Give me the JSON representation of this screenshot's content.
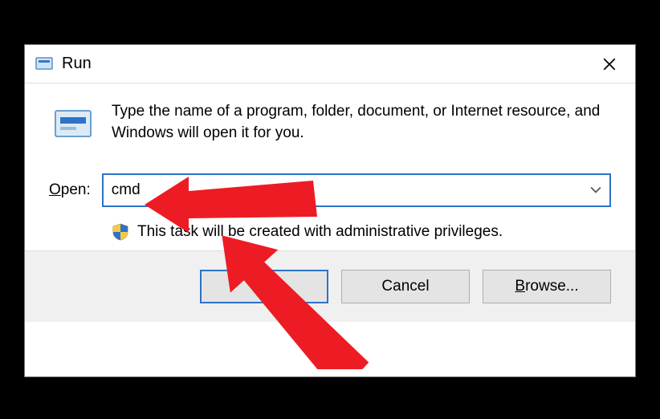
{
  "window": {
    "title": "Run",
    "close_label": "✕"
  },
  "content": {
    "description": "Type the name of a program, folder, document, or Internet resource, and Windows will open it for you.",
    "open_label_prefix": "O",
    "open_label_rest": "pen:",
    "input_value": "cmd",
    "admin_privileges_text": "This task will be created with administrative privileges."
  },
  "buttons": {
    "ok": "OK",
    "cancel": "Cancel",
    "browse_prefix": "B",
    "browse_rest": "rowse..."
  }
}
